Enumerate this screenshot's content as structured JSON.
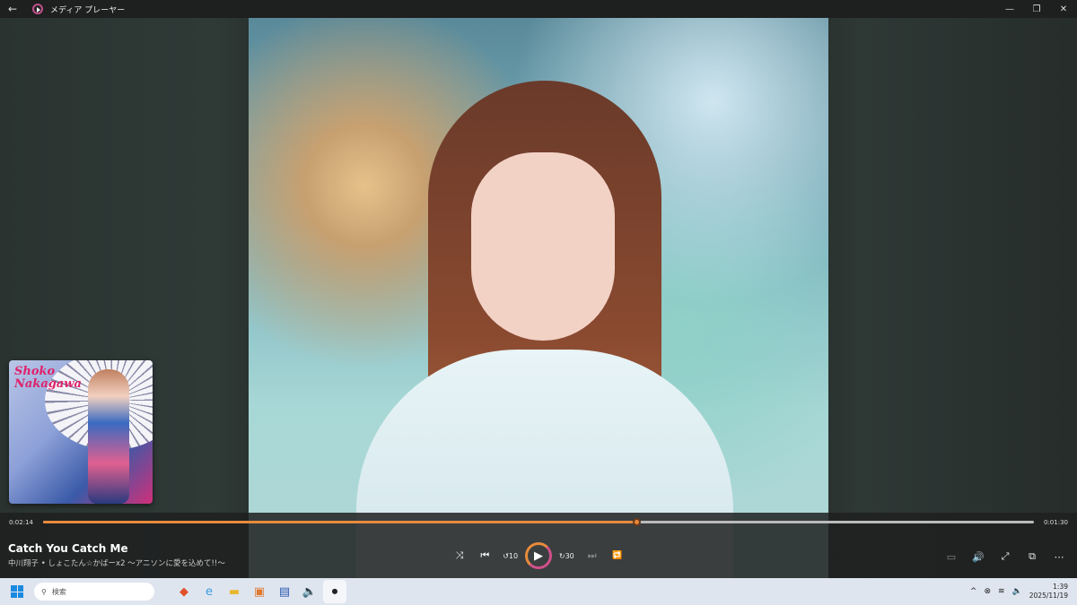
{
  "titlebar": {
    "title": "メディア プレーヤー",
    "back": "←",
    "minimize": "—",
    "restore": "❐",
    "close": "✕"
  },
  "album": {
    "logo": "Shoko Nakagawa"
  },
  "playback": {
    "elapsed": "0:02:14",
    "remaining": "0:01:30",
    "progress": 0.599
  },
  "track": {
    "title": "Catch You Catch Me",
    "subtitle": "中川翔子 • しょこたん☆かばーx2 〜アニソンに愛を込めて!!〜"
  },
  "controls": {
    "shuffle": "⤨",
    "previous": "⏮",
    "rewind": "↺10",
    "play": "▶",
    "forward": "↻30",
    "next": "⏭",
    "repeat": "🔁"
  },
  "right_controls": {
    "miniplayer": "▭",
    "volume": "🔊",
    "fullscreen": "⤢",
    "cast": "⧉",
    "more": "⋯"
  },
  "taskbar": {
    "search_placeholder": "検索",
    "time": "1:39",
    "date": "2025/11/19"
  },
  "colors": {
    "accent": "#e88a3c",
    "accent2": "#d0508a"
  }
}
